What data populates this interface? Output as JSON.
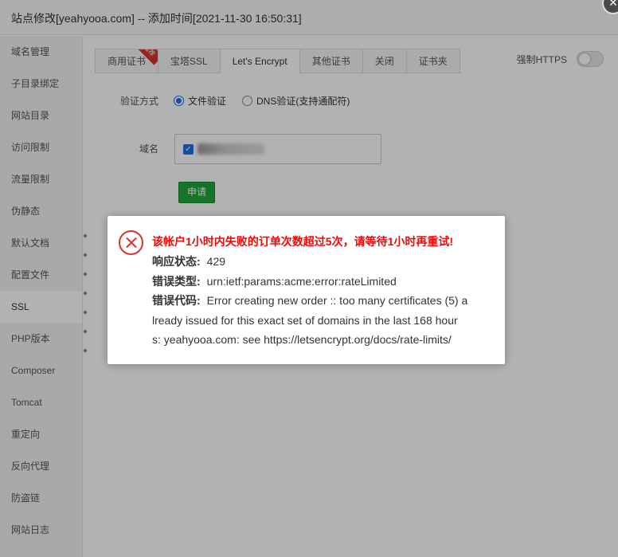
{
  "window": {
    "title": "站点修改[yeahyooa.com] -- 添加时间[2021-11-30 16:50:31]",
    "close_icon": "close-icon"
  },
  "sidebar": {
    "items": [
      {
        "label": "域名管理"
      },
      {
        "label": "子目录绑定"
      },
      {
        "label": "网站目录"
      },
      {
        "label": "访问限制"
      },
      {
        "label": "流量限制"
      },
      {
        "label": "伪静态"
      },
      {
        "label": "默认文档"
      },
      {
        "label": "配置文件"
      },
      {
        "label": "SSL",
        "active": true
      },
      {
        "label": "PHP版本"
      },
      {
        "label": "Composer"
      },
      {
        "label": "Tomcat"
      },
      {
        "label": "重定向"
      },
      {
        "label": "反向代理"
      },
      {
        "label": "防盗链"
      },
      {
        "label": "网站日志"
      }
    ]
  },
  "tabs": [
    {
      "label": "商用证书",
      "badge": "推荐"
    },
    {
      "label": "宝塔SSL"
    },
    {
      "label": "Let's Encrypt",
      "active": true
    },
    {
      "label": "其他证书"
    },
    {
      "label": "关闭"
    },
    {
      "label": "证书夹"
    }
  ],
  "force_https": {
    "label": "强制HTTPS",
    "enabled": false
  },
  "form": {
    "verify_label": "验证方式",
    "verify_options": [
      {
        "label": "文件验证",
        "selected": true
      },
      {
        "label": "DNS验证(支持通配符)",
        "selected": false
      }
    ],
    "domain_label": "域名",
    "domain_checked": true,
    "apply_label": "申请"
  },
  "dialog": {
    "title": "该帐户1小时内失败的订单次数超过5次，请等待1小时再重试!",
    "status_label": "响应状态:",
    "status_value": "429",
    "type_label": "错误类型:",
    "type_value": "urn:ietf:params:acme:error:rateLimited",
    "code_label": "错误代码:",
    "code_value_1": "Error creating new order :: too many certificates (5) a",
    "code_value_2": "lready issued for this exact set of domains in the last 168 hour",
    "code_value_3": "s: yeahyooa.com: see https://letsencrypt.org/docs/rate-limits/"
  }
}
